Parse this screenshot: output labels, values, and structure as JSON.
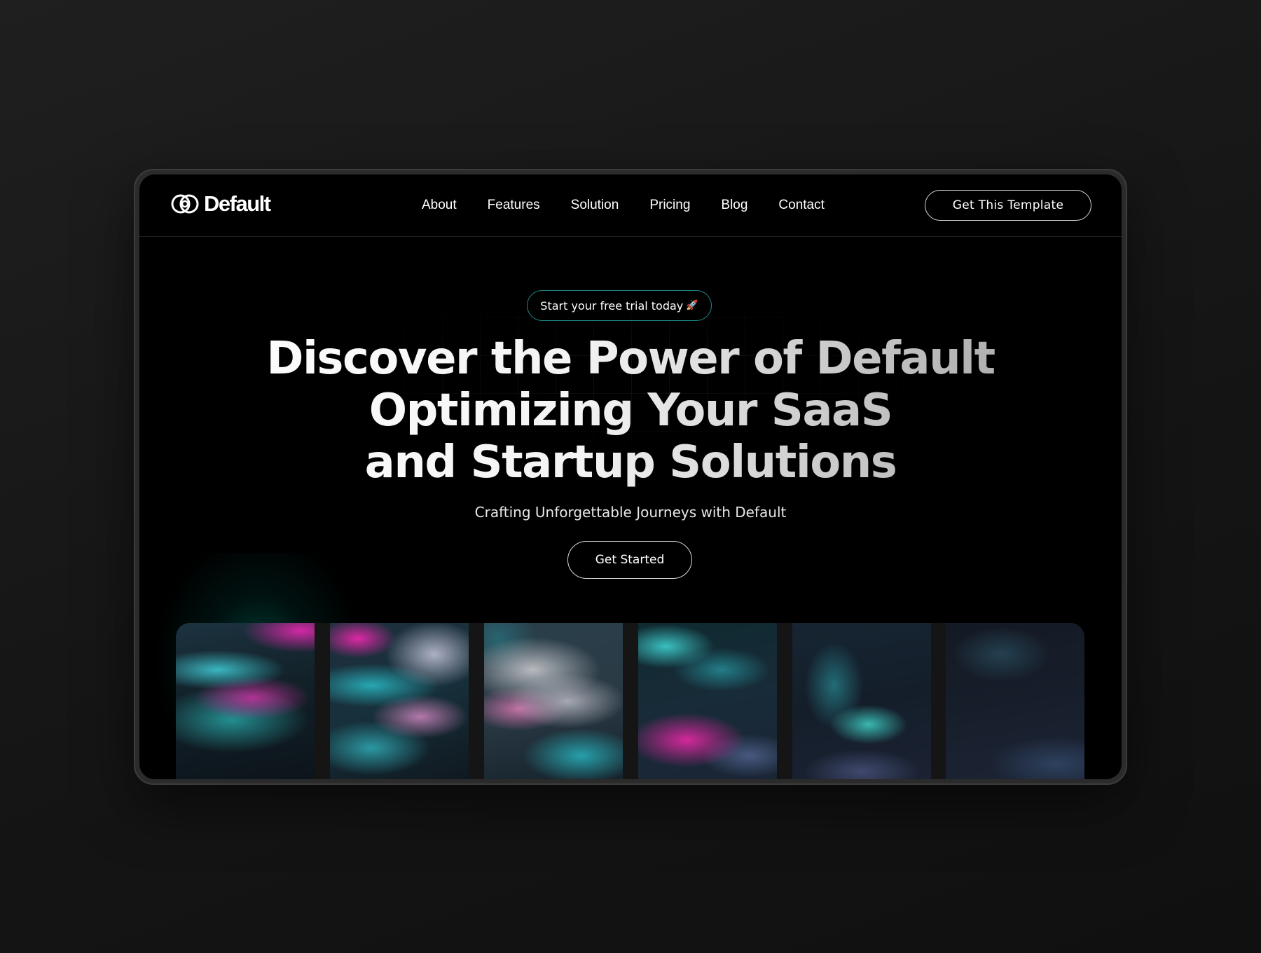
{
  "brand": {
    "name": "Default",
    "logo_icon": "linked-rings-logo-icon"
  },
  "nav": {
    "items": [
      {
        "label": "About"
      },
      {
        "label": "Features"
      },
      {
        "label": "Solution"
      },
      {
        "label": "Pricing"
      },
      {
        "label": "Blog"
      },
      {
        "label": "Contact"
      }
    ],
    "cta_label": "Get This Template"
  },
  "hero": {
    "badge_text": "Start your free trial today",
    "badge_icon": "rocket-icon",
    "headline_lines": [
      "Discover the Power of Default",
      "Optimizing Your SaaS",
      "and Startup Solutions"
    ],
    "subtitle": "Crafting Unforgettable Journeys with Default",
    "cta_label": "Get Started"
  },
  "gallery": {
    "tiles": [
      {
        "name": "abstract-wave-1"
      },
      {
        "name": "abstract-wave-2"
      },
      {
        "name": "abstract-wave-3"
      },
      {
        "name": "abstract-wave-4"
      },
      {
        "name": "abstract-wave-5"
      },
      {
        "name": "abstract-wave-6"
      }
    ]
  },
  "colors": {
    "background": "#000000",
    "accent_teal": "#1f8a86",
    "accent_magenta": "#d62aa8",
    "text": "#ffffff"
  }
}
